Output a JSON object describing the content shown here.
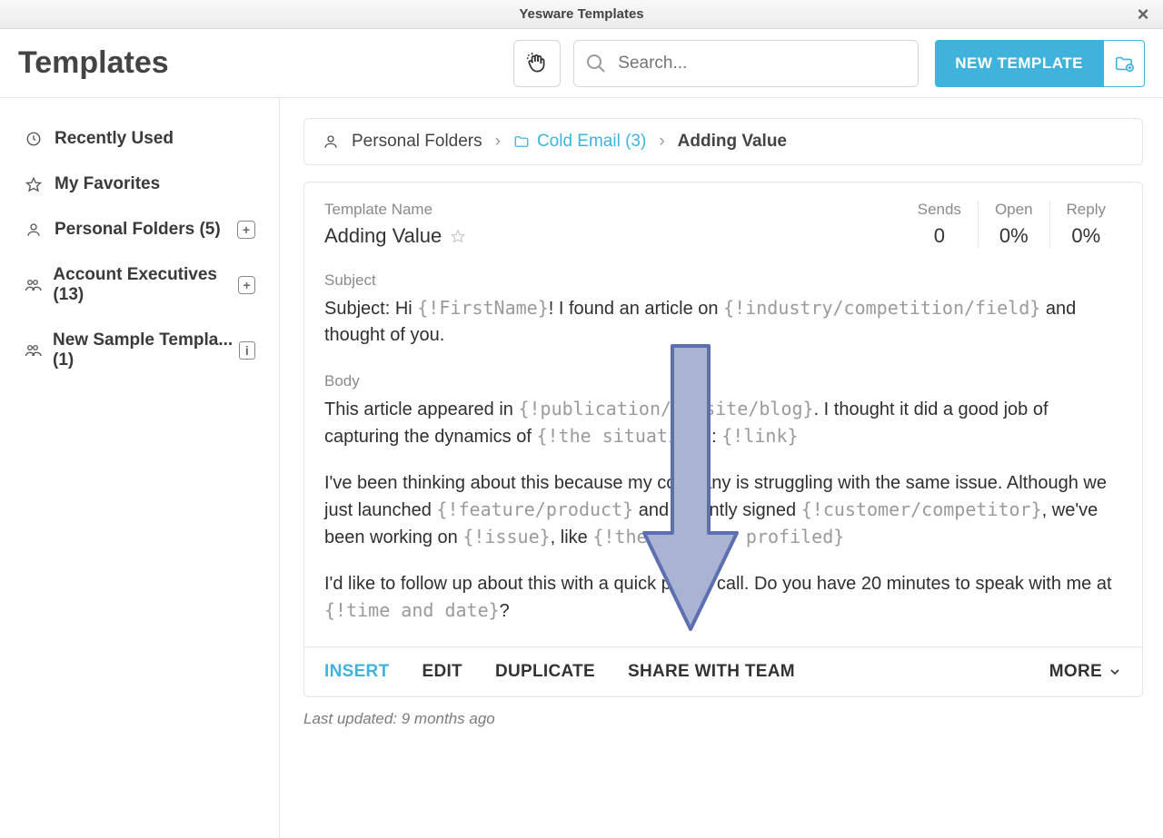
{
  "window": {
    "title": "Yesware Templates"
  },
  "page": {
    "heading": "Templates"
  },
  "search": {
    "placeholder": "Search..."
  },
  "buttons": {
    "new_template": "NEW TEMPLATE"
  },
  "sidebar": {
    "items": [
      {
        "label": "Recently Used"
      },
      {
        "label": "My Favorites"
      },
      {
        "label": "Personal Folders (5)"
      },
      {
        "label": "Account Executives (13)"
      },
      {
        "label": "New Sample Templa... (1)"
      }
    ]
  },
  "breadcrumb": {
    "root": "Personal Folders",
    "folder": "Cold Email (3)",
    "current": "Adding Value"
  },
  "template": {
    "name_label": "Template Name",
    "name": "Adding Value",
    "stats": {
      "sends_label": "Sends",
      "sends": "0",
      "open_label": "Open",
      "open": "0%",
      "reply_label": "Reply",
      "reply": "0%"
    },
    "subject_label": "Subject",
    "subject_prefix": "Subject: Hi ",
    "subject_var1": "{!FirstName}",
    "subject_mid": "! I found an article on ",
    "subject_var2": "{!industry/competition/field}",
    "subject_suffix": " and thought of you.",
    "body_label": "Body",
    "body": {
      "p1_a": "This article appeared in ",
      "p1_v1": "{!publication/website/blog}",
      "p1_b": ". I thought it did a good job of capturing the dynamics of ",
      "p1_v2": "{!the situation}",
      "p1_c": ": ",
      "p1_v3": "{!link}",
      "p2_a": "I've been thinking about this because my company is struggling with the same issue. Although we just launched ",
      "p2_v1": "{!feature/product}",
      "p2_b": " and recently signed ",
      "p2_v2": "{!customer/competitor}",
      "p2_c": ", we've been working on ",
      "p2_v3": "{!issue}",
      "p2_d": ", like ",
      "p2_v4": "{!the company profiled}",
      "p3_a": "I'd like to follow up about this with a quick phone call. Do you have 20 minutes to speak with me at ",
      "p3_v1": "{!time and date}",
      "p3_b": "?"
    }
  },
  "actions": {
    "insert": "INSERT",
    "edit": "EDIT",
    "duplicate": "DUPLICATE",
    "share": "SHARE WITH TEAM",
    "more": "MORE"
  },
  "footer": {
    "last_updated": "Last updated: 9 months ago"
  }
}
